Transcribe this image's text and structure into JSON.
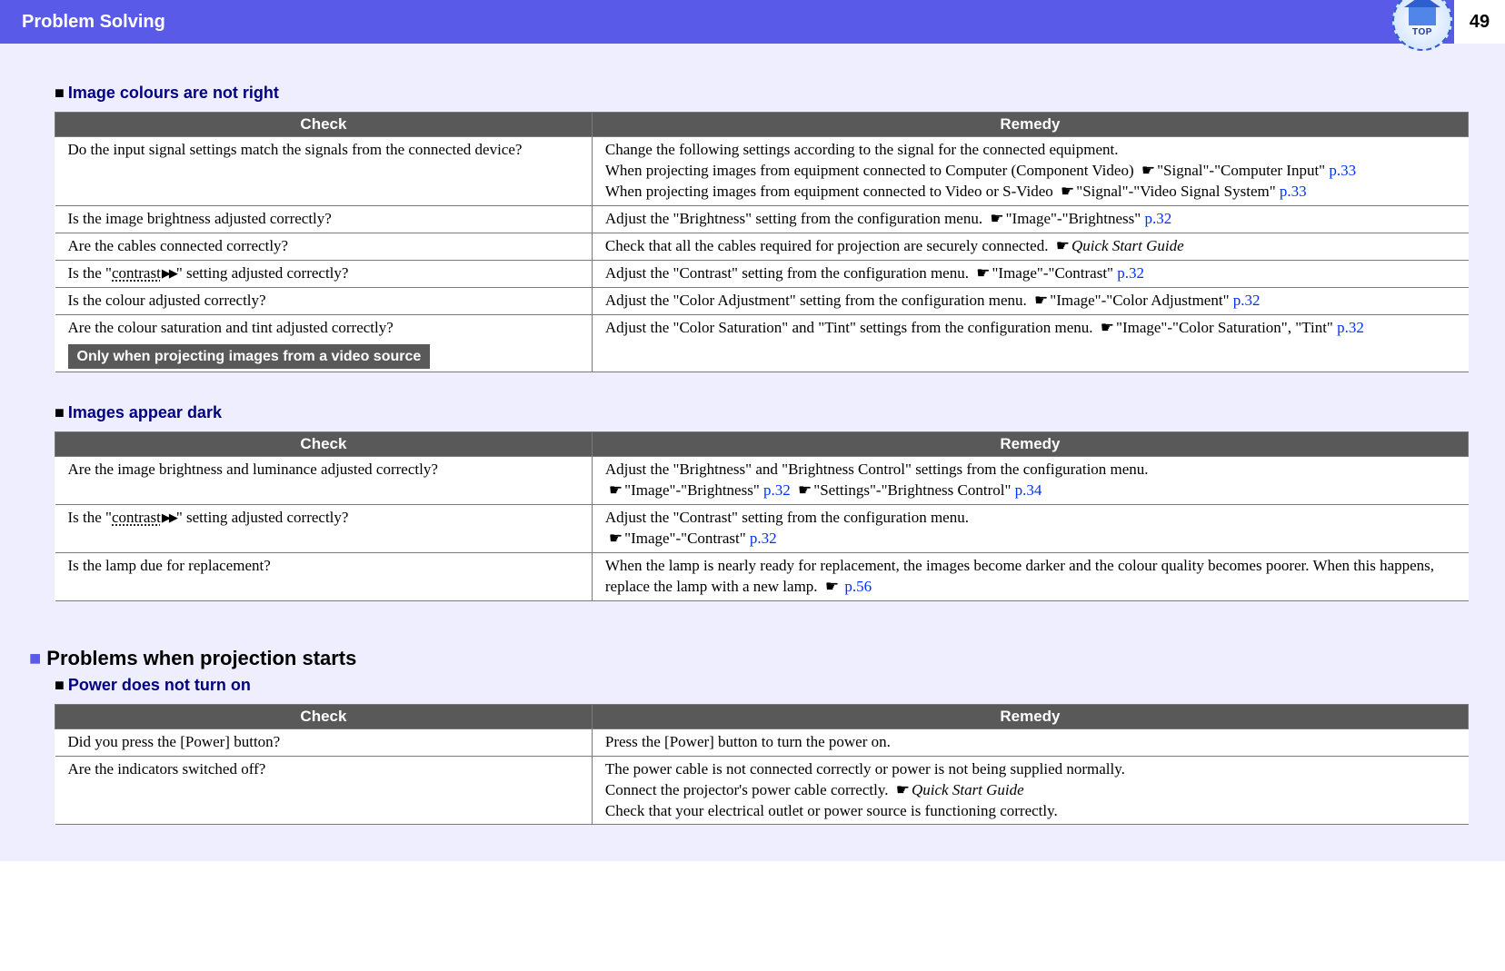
{
  "header": {
    "title": "Problem Solving",
    "page_number": "49",
    "top_icon_label": "TOP"
  },
  "headings": {
    "h1": "Image colours are not right",
    "h2": "Images appear dark",
    "section": "Problems when projection starts",
    "h3": "Power does not turn on",
    "check": "Check",
    "remedy": "Remedy"
  },
  "tags": {
    "video_only": "Only when projecting images from a video source"
  },
  "glossary": {
    "contrast": "contrast"
  },
  "refs": {
    "qsg": "Quick Start Guide",
    "p32": "p.32",
    "p33": "p.33",
    "p34": "p.34",
    "p56": "p.56"
  },
  "table1": {
    "r1c": "Do the input signal settings match the signals from the connected device?",
    "r1r_a": "Change the following settings according to the signal for the connected equipment.",
    "r1r_b": "When projecting images from equipment connected to Computer (Component Video) ",
    "r1r_b_ref": "\"Signal\"-\"Computer Input\" ",
    "r1r_c": "When projecting images from equipment connected to Video or S-Video ",
    "r1r_c_ref": "\"Signal\"-\"Video Signal System\" ",
    "r2c": "Is the image brightness adjusted correctly?",
    "r2r": "Adjust the \"Brightness\" setting from the configuration menu. ",
    "r2r_ref": "\"Image\"-\"Brightness\" ",
    "r3c": "Are the cables connected correctly?",
    "r3r": "Check that all the cables required for projection are securely connected. ",
    "r4c_a": "Is the \"",
    "r4c_b": "\" setting adjusted correctly?",
    "r4r": "Adjust the \"Contrast\" setting from the configuration menu. ",
    "r4r_ref": "\"Image\"-\"Contrast\" ",
    "r5c": "Is the colour adjusted correctly?",
    "r5r": "Adjust the \"Color Adjustment\" setting from the configuration menu. ",
    "r5r_ref": "\"Image\"-\"Color Adjustment\" ",
    "r6c": "Are the colour saturation and tint adjusted correctly?",
    "r6r": "Adjust the \"Color Saturation\" and \"Tint\" settings from the configuration menu. ",
    "r6r_ref": "\"Image\"-\"Color Saturation\", \"Tint\" "
  },
  "table2": {
    "r1c": "Are the image brightness and luminance adjusted correctly?",
    "r1r_a": "Adjust the \"Brightness\" and \"Brightness Control\" settings from the configuration menu.",
    "r1r_ref1": "\"Image\"-\"Brightness\" ",
    "r1r_ref2": "\"Settings\"-\"Brightness Control\" ",
    "r2c_a": "Is the \"",
    "r2c_b": "\" setting adjusted correctly?",
    "r2r_a": "Adjust the \"Contrast\" setting from the configuration menu.",
    "r2r_ref": "\"Image\"-\"Contrast\" ",
    "r3c": "Is the lamp due for replacement?",
    "r3r": "When the lamp is nearly ready for replacement, the images become darker and the colour quality becomes poorer. When this happens, replace the lamp with a new lamp. "
  },
  "table3": {
    "r1c": "Did you press the [Power] button?",
    "r1r": "Press the [Power] button to turn the power on.",
    "r2c": "Are the indicators switched off?",
    "r2r_a": "The power cable is not connected correctly or power is not being supplied normally.",
    "r2r_b": "Connect the projector's power cable correctly. ",
    "r2r_c": "Check that your electrical outlet or power source is functioning correctly."
  }
}
